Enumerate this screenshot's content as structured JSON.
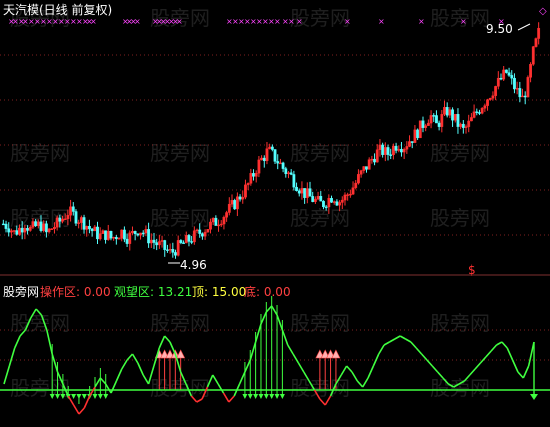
{
  "chart_data": [
    {
      "type": "candlestick",
      "title": "天汽模(日线 前复权)",
      "colors": {
        "up": "#ff3030",
        "down": "#54ffff",
        "marker_pink": "#ff44ff",
        "max_label": "#ffffff",
        "signal_dollar": "#ff3030"
      },
      "ylim": [
        4.7,
        9.6
      ],
      "annotations": {
        "high_label": "9.50",
        "low_label": "4.96",
        "signal_mark": "$"
      },
      "close_series": [
        5.6,
        5.55,
        5.42,
        5.5,
        5.62,
        5.48,
        5.55,
        5.58,
        5.4,
        5.52,
        5.6,
        5.72,
        5.85,
        5.78,
        5.7,
        5.62,
        5.5,
        5.42,
        5.35,
        5.4,
        5.3,
        5.38,
        5.45,
        5.32,
        5.4,
        5.5,
        5.42,
        5.3,
        5.22,
        5.15,
        5.08,
        5.0,
        5.1,
        5.18,
        5.25,
        5.32,
        5.4,
        5.48,
        5.55,
        5.62,
        5.7,
        5.8,
        5.92,
        6.05,
        6.2,
        6.35,
        6.55,
        6.8,
        6.95,
        7.1,
        6.98,
        6.85,
        6.7,
        6.6,
        6.45,
        6.3,
        6.2,
        6.12,
        6.05,
        6.0,
        6.1,
        6.18,
        6.05,
        6.12,
        6.25,
        6.4,
        6.6,
        6.75,
        6.9,
        7.05,
        7.1,
        7.02,
        7.15,
        7.25,
        7.18,
        7.3,
        7.4,
        7.55,
        7.7,
        7.82,
        7.6,
        7.75,
        7.92,
        7.8,
        7.65,
        7.5,
        7.62,
        7.8,
        7.95,
        8.1,
        8.25,
        8.4,
        8.55,
        8.7,
        8.5,
        8.3,
        8.15,
        8.45,
        9.1,
        9.5
      ]
    },
    {
      "type": "line",
      "title": "股旁网",
      "legend": [
        {
          "label": "操作区: 0.00",
          "color": "#ff4040"
        },
        {
          "label": "观望区: 13.21",
          "color": "#40ff40"
        },
        {
          "label": "顶: 15.00",
          "color": "#ffff40"
        },
        {
          "label": "底: 0.00",
          "color": "#ff4040"
        }
      ],
      "ylim": [
        -10,
        30
      ],
      "zero_line": 0,
      "series": [
        2,
        8,
        14,
        18,
        20,
        24,
        27,
        25,
        20,
        12,
        6,
        2,
        -2,
        -5,
        -8,
        -6,
        -2,
        1,
        4,
        2,
        -1,
        3,
        7,
        10,
        12,
        9,
        5,
        2,
        8,
        14,
        18,
        16,
        12,
        6,
        2,
        -2,
        -4,
        -3,
        1,
        5,
        2,
        -1,
        -4,
        -2,
        2,
        6,
        10,
        16,
        22,
        26,
        28,
        25,
        20,
        15,
        12,
        9,
        6,
        3,
        0,
        -3,
        -5,
        -2,
        2,
        5,
        8,
        6,
        3,
        1,
        4,
        8,
        12,
        15,
        16,
        17,
        18,
        17,
        16,
        14,
        12,
        10,
        8,
        6,
        4,
        2,
        1,
        2,
        3,
        5,
        7,
        9,
        11,
        13,
        15,
        16,
        14,
        10,
        6,
        4,
        8,
        16
      ],
      "buy_signal_indices": [
        9,
        10,
        11,
        12,
        13,
        14,
        15,
        16,
        17,
        18,
        19,
        45,
        46,
        47,
        48,
        49,
        50,
        51,
        52
      ],
      "top_signal_indices": [
        29,
        30,
        31,
        32,
        33,
        59,
        60,
        61,
        62
      ]
    }
  ],
  "watermark": "股旁网"
}
